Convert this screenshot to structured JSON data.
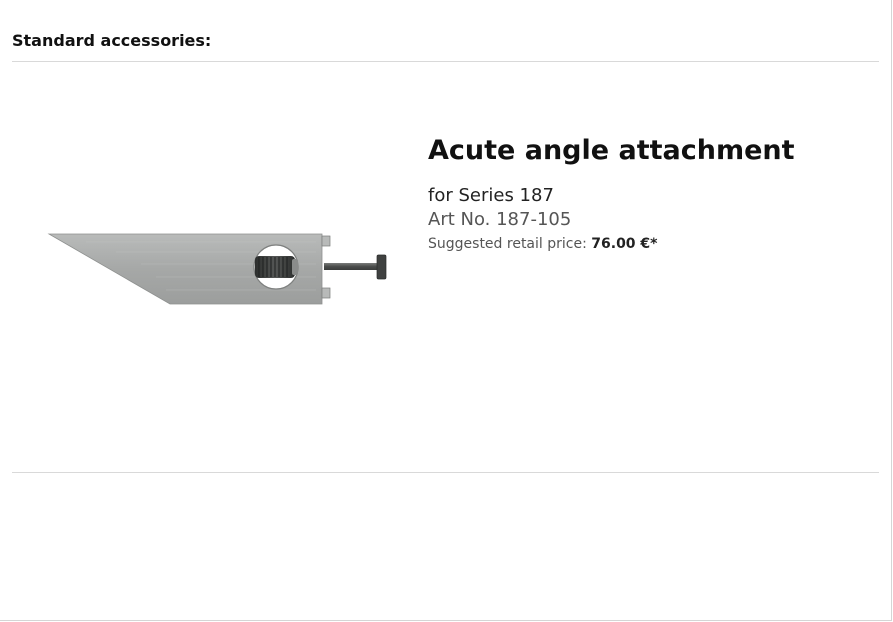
{
  "section": {
    "title": "Standard accessories:"
  },
  "product": {
    "name": "Acute angle attachment",
    "series": "for Series 187",
    "art_no": "Art No. 187-105",
    "price_label": "Suggested retail price:",
    "price_value": "76.00 €*",
    "image_icon": "acute-angle-attachment-photo"
  },
  "colors": {
    "metal": "#a9abaa",
    "metal_dark": "#6a6c6b",
    "screw_dark": "#3c3e3d",
    "rule": "#d9d9d9"
  }
}
